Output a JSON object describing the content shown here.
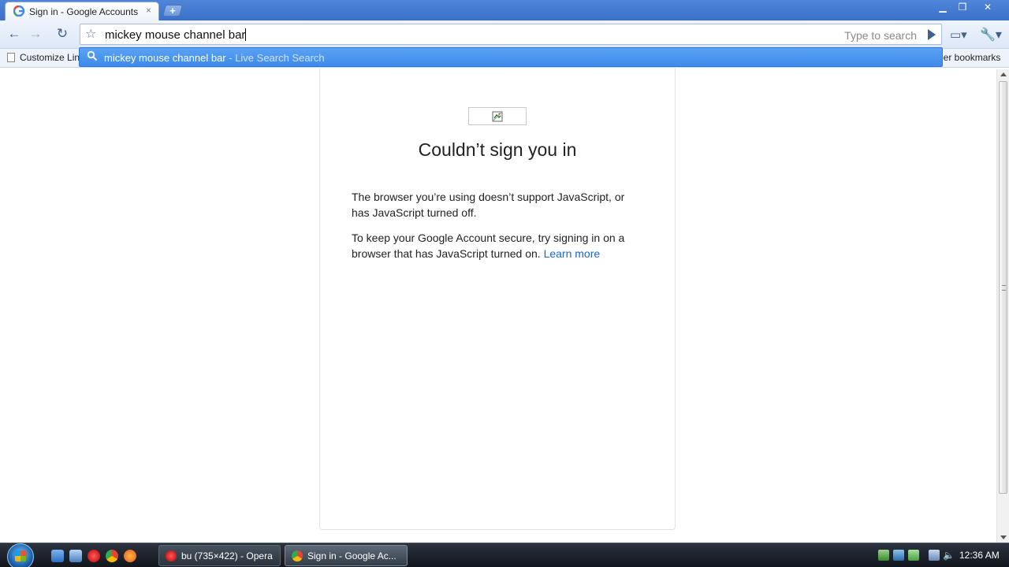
{
  "browser": {
    "tab_title": "Sign in - Google Accounts",
    "tab_close": "×",
    "new_tab": "+",
    "window_controls": {
      "minimize": "▁",
      "maximize": "❐",
      "close": "✕"
    }
  },
  "toolbar": {
    "back": "←",
    "forward": "→",
    "reload": "↻",
    "star": "☆",
    "omnibox_text": "mickey mouse channel bar",
    "omnibox_hint": "Type to search",
    "page_menu": "▭▾",
    "wrench_menu": "🔧▾"
  },
  "bookmarks": {
    "left_label": "Customize Lin",
    "right_label": "her bookmarks"
  },
  "suggestion": {
    "query": "mickey mouse channel bar",
    "description": " - Live Search Search"
  },
  "card": {
    "heading": "Couldn’t sign you in",
    "para1": "The browser you’re using doesn’t support JavaScript, or has JavaScript turned off.",
    "para2": "To keep your Google Account secure, try signing in on a browser that has JavaScript turned on. ",
    "learn_more": "Learn more"
  },
  "taskbar": {
    "tasks": [
      {
        "label": "bu (735×422) - Opera"
      },
      {
        "label": "Sign in - Google Ac..."
      }
    ],
    "clock": "12:36 AM"
  },
  "colors": {
    "link": "#1a67c8",
    "suggest_bg": "#3d8beb",
    "titlebar": "#4f86d9"
  }
}
